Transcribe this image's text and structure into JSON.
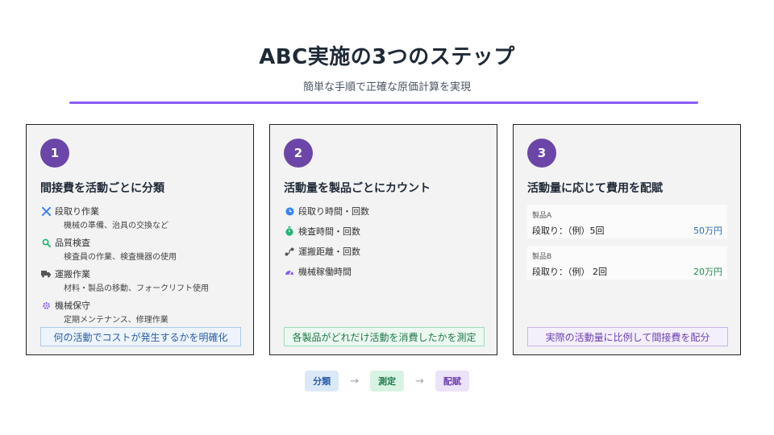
{
  "header": {
    "title": "ABC実施の3つのステップ",
    "subtitle": "簡単な手順で正確な原価計算を実現"
  },
  "colors": {
    "accent": "#8b5cf6",
    "badge": "#6b46a8"
  },
  "steps": [
    {
      "number": "1",
      "title": "間接費を活動ごとに分類",
      "items": [
        {
          "icon": "tools-icon",
          "label": "段取り作業",
          "desc": "機械の準備、治具の交換など"
        },
        {
          "icon": "search-icon",
          "label": "品質検査",
          "desc": "検査員の作業、検査機器の使用"
        },
        {
          "icon": "truck-icon",
          "label": "運搬作業",
          "desc": "材料・製品の移動、フォークリフト使用"
        },
        {
          "icon": "gear-icon",
          "label": "機械保守",
          "desc": "定期メンテナンス、修理作業"
        }
      ],
      "footer": "何の活動でコストが発生するかを明確化"
    },
    {
      "number": "2",
      "title": "活動量を製品ごとにカウント",
      "items": [
        {
          "icon": "clock-icon",
          "label": "段取り時間・回数"
        },
        {
          "icon": "stopwatch-icon",
          "label": "検査時間・回数"
        },
        {
          "icon": "route-icon",
          "label": "運搬距離・回数"
        },
        {
          "icon": "gauge-icon",
          "label": "機械稼働時間"
        }
      ],
      "footer": "各製品がどれだけ活動を消費したかを測定"
    },
    {
      "number": "3",
      "title": "活動量に応じて費用を配賦",
      "products": [
        {
          "name": "製品A",
          "detail": "段取り：（例）5回",
          "amount": "50万円"
        },
        {
          "name": "製品B",
          "detail": "段取り：（例） 2回",
          "amount": "20万円"
        }
      ],
      "footer": "実際の活動量に比例して間接費を配分"
    }
  ],
  "flow": {
    "step1": "分類",
    "step2": "測定",
    "step3": "配賦",
    "arrow": "→"
  }
}
